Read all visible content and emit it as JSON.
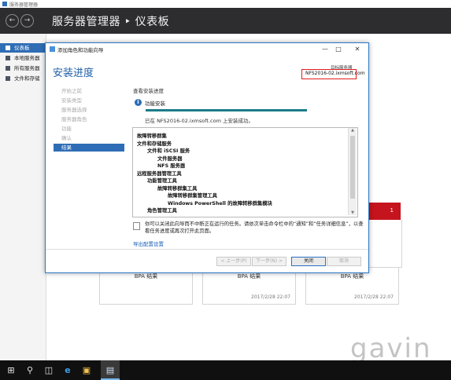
{
  "window": {
    "app_title": "服务器管理器",
    "header_crumb": "服务器管理器 ‣ 仪表板",
    "back_icon": "back-arrow-icon",
    "forward_icon": "forward-arrow-icon"
  },
  "sidebar": {
    "items": [
      {
        "label": "仪表板",
        "active": true
      },
      {
        "label": "本地服务器",
        "active": false
      },
      {
        "label": "所有服务器",
        "active": false
      },
      {
        "label": "文件和存储",
        "active": false
      }
    ]
  },
  "dashboard": {
    "red_card_count": "1",
    "tiles": [
      {
        "label": "BPA 结果",
        "date": ""
      },
      {
        "label": "BPA 结果",
        "date": "2017/2/28 22:07"
      },
      {
        "label": "BPA 结果",
        "date": "2017/2/28 22:07"
      }
    ]
  },
  "wizard": {
    "title": "添加角色和功能向导",
    "heading": "安装进度",
    "target_label": "目标服务器",
    "target_value": "NFS2016-02.ixmsoft.com",
    "steps": [
      {
        "label": "开始之前",
        "active": false
      },
      {
        "label": "安装类型",
        "active": false
      },
      {
        "label": "服务器选择",
        "active": false
      },
      {
        "label": "服务器角色",
        "active": false
      },
      {
        "label": "功能",
        "active": false
      },
      {
        "label": "确认",
        "active": false
      },
      {
        "label": "结果",
        "active": true
      }
    ],
    "section_title": "查看安装进度",
    "info_label": "功能安装",
    "progress": 1.0,
    "status_text": "已在 NFS2016-02.ixmsoft.com 上安装成功。",
    "results": [
      {
        "text": "故障转移群集",
        "indent": 0
      },
      {
        "text": "文件和存储服务",
        "indent": 0
      },
      {
        "text": "文件和 iSCSI 服务",
        "indent": 1
      },
      {
        "text": "文件服务器",
        "indent": 2
      },
      {
        "text": "NFS 服务器",
        "indent": 2
      },
      {
        "text": "远程服务器管理工具",
        "indent": 0
      },
      {
        "text": "功能管理工具",
        "indent": 1
      },
      {
        "text": "故障转移群集工具",
        "indent": 2
      },
      {
        "text": "故障转移群集管理工具",
        "indent": 3
      },
      {
        "text": "Windows PowerShell 的故障转移群集模块",
        "indent": 3
      },
      {
        "text": "角色管理工具",
        "indent": 1
      }
    ],
    "note": "你可以关闭此向导而不中断正在运行的任务。请依次单击命令栏中的“通知”和“任务详细信息”，以查看任务进度或再次打开此页面。",
    "export_link": "导出配置设置",
    "buttons": {
      "prev": "< 上一步(P)",
      "next": "下一步(N) >",
      "close": "关闭",
      "cancel": "取消"
    }
  },
  "watermark": "gavin",
  "taskbar": {
    "items": [
      "start-icon",
      "search-icon",
      "task-view-icon",
      "ie-icon",
      "explorer-icon",
      "server-manager-icon"
    ]
  },
  "colors": {
    "header_bg": "#2d2d30",
    "accent": "#2e6db5",
    "progress": "#1b7c88",
    "alert_red": "#c5141d",
    "highlight_box": "#e11d1d"
  }
}
